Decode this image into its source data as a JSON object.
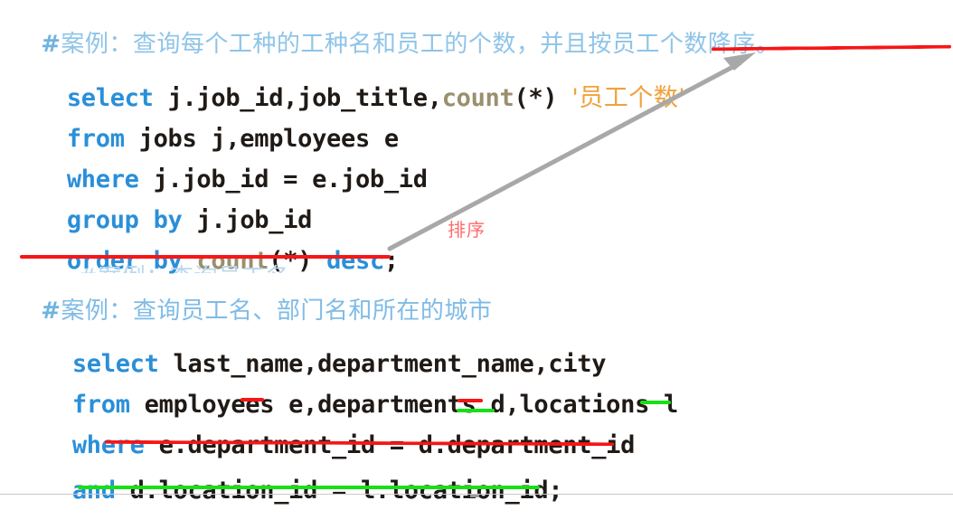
{
  "page": {
    "background": "#ffffff",
    "bottom_rule_color": "#c9c9c9"
  },
  "colors": {
    "keyword": "#2a8fd8",
    "identifier": "#201a16",
    "function": "#9a8f6e",
    "string_literal": "#f0a23c",
    "comment": "#8fc4e8",
    "underline_red": "#f61616",
    "underline_green": "#16e016",
    "note_red": "#ff6b6b",
    "arrow_gray": "#a8a8a8"
  },
  "query_one": {
    "comment": "#案例：查询每个工种的工种名和员工的个数，并且按员工个数降序。",
    "comment_hash": "#",
    "comment_body": "案例：查询每个工种的工种名和员工的个数，并且按员工个数降序。",
    "lines": [
      {
        "id": "select-line",
        "tokens": [
          {
            "text": "select",
            "kind": "kw"
          },
          {
            "text": " ",
            "kind": "punct"
          },
          {
            "text": "j.job_id,job_title,",
            "kind": "ident"
          },
          {
            "text": "count",
            "kind": "fn"
          },
          {
            "text": "(*)",
            "kind": "ident"
          },
          {
            "text": " ",
            "kind": "punct"
          },
          {
            "text": "'员工个数'",
            "kind": "str"
          }
        ]
      },
      {
        "id": "from-line",
        "tokens": [
          {
            "text": "from",
            "kind": "kw"
          },
          {
            "text": " jobs j,employees e",
            "kind": "ident"
          }
        ]
      },
      {
        "id": "where-line",
        "tokens": [
          {
            "text": "where",
            "kind": "kw"
          },
          {
            "text": " j.job_id = e.job_id",
            "kind": "ident"
          }
        ]
      },
      {
        "id": "group-by-line",
        "tokens": [
          {
            "text": "group",
            "kind": "kw"
          },
          {
            "text": " ",
            "kind": "punct"
          },
          {
            "text": "by",
            "kind": "kw"
          },
          {
            "text": " j.job_id",
            "kind": "ident"
          }
        ]
      },
      {
        "id": "order-by-line",
        "tokens": [
          {
            "text": "order",
            "kind": "kw"
          },
          {
            "text": " ",
            "kind": "punct"
          },
          {
            "text": "by",
            "kind": "kw"
          },
          {
            "text": " ",
            "kind": "punct"
          },
          {
            "text": "count",
            "kind": "fn"
          },
          {
            "text": "(*)",
            "kind": "ident"
          },
          {
            "text": " ",
            "kind": "punct"
          },
          {
            "text": "desc",
            "kind": "kw"
          },
          {
            "text": ";",
            "kind": "ident"
          }
        ]
      }
    ],
    "annotation_note": "排序"
  },
  "query_two": {
    "comment": "#案例：查询员工名、部门名和所在的城市",
    "comment_hash": "#",
    "comment_body": "案例：查询员工名、部门名和所在的城市",
    "lines": [
      {
        "id": "select-line-2",
        "tokens": [
          {
            "text": "select",
            "kind": "kw"
          },
          {
            "text": " last_name,department_name,city",
            "kind": "ident"
          }
        ]
      },
      {
        "id": "from-line-2",
        "tokens": [
          {
            "text": "from",
            "kind": "kw"
          },
          {
            "text": " employees e,departments d,locations l",
            "kind": "ident"
          }
        ]
      },
      {
        "id": "where-line-2",
        "tokens": [
          {
            "text": "where",
            "kind": "kw"
          },
          {
            "text": " e.department_id = d.department_id",
            "kind": "ident"
          }
        ]
      },
      {
        "id": "and-line-2",
        "tokens": [
          {
            "text": "and",
            "kind": "kw"
          },
          {
            "text": " d.location_id = l.location_id;",
            "kind": "ident"
          }
        ]
      }
    ]
  },
  "ghost_text": "#案例：查询员工名"
}
